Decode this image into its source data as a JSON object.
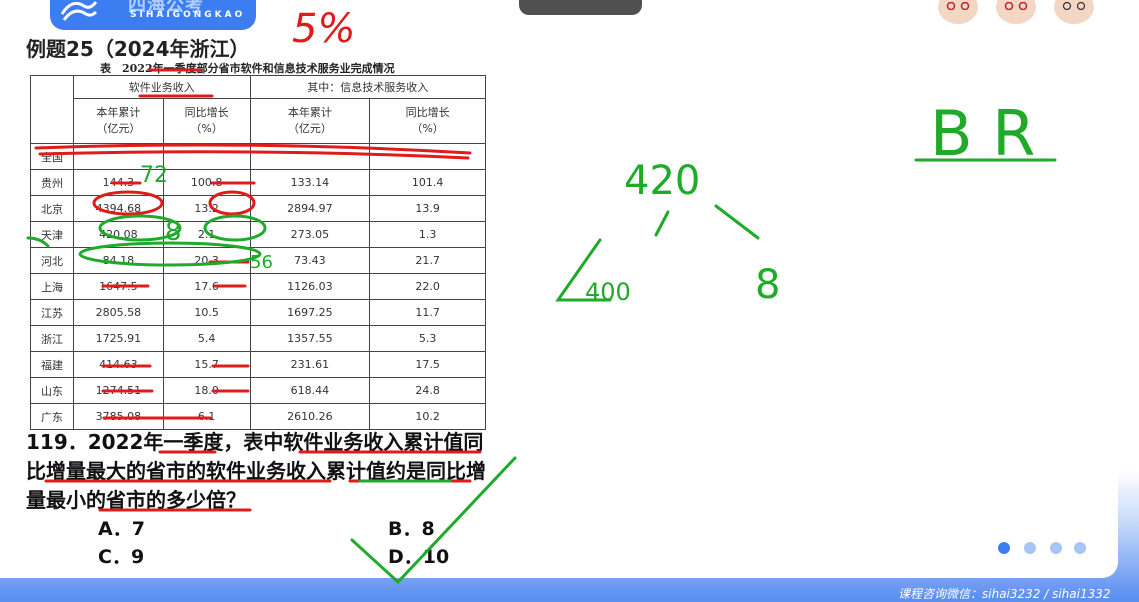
{
  "logo": {
    "text": "四海公考",
    "sub": "SIHAIGONGKAO"
  },
  "heading": "例题25（2024年浙江）",
  "table": {
    "caption": "表　2022年一季度部分省市软件和信息技术服务业完成情况",
    "group_headers": [
      "软件业务收入",
      "其中：信息技术服务收入"
    ],
    "col_headers": [
      "本年累计\n（亿元）",
      "同比增长\n（%）",
      "本年累计\n（亿元）",
      "同比增长\n（%）"
    ],
    "rows": [
      {
        "region": "全国",
        "v1": "",
        "v2": "",
        "v3": "",
        "v4": ""
      },
      {
        "region": "贵州",
        "v1": "144.3",
        "v2": "100.8",
        "v3": "133.14",
        "v4": "101.4"
      },
      {
        "region": "北京",
        "v1": "4394.68",
        "v2": "13.2",
        "v3": "2894.97",
        "v4": "13.9"
      },
      {
        "region": "天津",
        "v1": "420.08",
        "v2": "2.1",
        "v3": "273.05",
        "v4": "1.3"
      },
      {
        "region": "河北",
        "v1": "84.18",
        "v2": "20.3",
        "v3": "73.43",
        "v4": "21.7"
      },
      {
        "region": "上海",
        "v1": "1647.5",
        "v2": "17.6",
        "v3": "1126.03",
        "v4": "22.0"
      },
      {
        "region": "江苏",
        "v1": "2805.58",
        "v2": "10.5",
        "v3": "1697.25",
        "v4": "11.7"
      },
      {
        "region": "浙江",
        "v1": "1725.91",
        "v2": "5.4",
        "v3": "1357.55",
        "v4": "5.3"
      },
      {
        "region": "福建",
        "v1": "414.63",
        "v2": "15.7",
        "v3": "231.61",
        "v4": "17.5"
      },
      {
        "region": "山东",
        "v1": "1274.51",
        "v2": "18.0",
        "v3": "618.44",
        "v4": "24.8"
      },
      {
        "region": "广东",
        "v1": "3785.08",
        "v2": "6.1",
        "v3": "2610.26",
        "v4": "10.2"
      }
    ]
  },
  "question": {
    "text": "119．2022年一季度，表中软件业务收入累计值同比增量最大的省市的软件业务收入累计值约是同比增量最小的省市的多少倍？",
    "options": [
      {
        "label": "A．7"
      },
      {
        "label": "B．8"
      },
      {
        "label": "C．9"
      },
      {
        "label": "D．10"
      }
    ]
  },
  "annotations": {
    "top": "5%",
    "guizhou_note": "72",
    "tianjin_note": "8",
    "hebei_note": "56",
    "tree_root": "420",
    "tree_left": "400",
    "tree_right": "8",
    "answer_marks": "B R"
  },
  "footer": {
    "wechat": "课程咨询微信：sihai3232 / sihai1332"
  },
  "pager": {
    "count": 4,
    "active": 1
  },
  "colors": {
    "brand": "#3c7ef2",
    "red_ink": "#e01b1b",
    "green_ink": "#1faa2a"
  }
}
